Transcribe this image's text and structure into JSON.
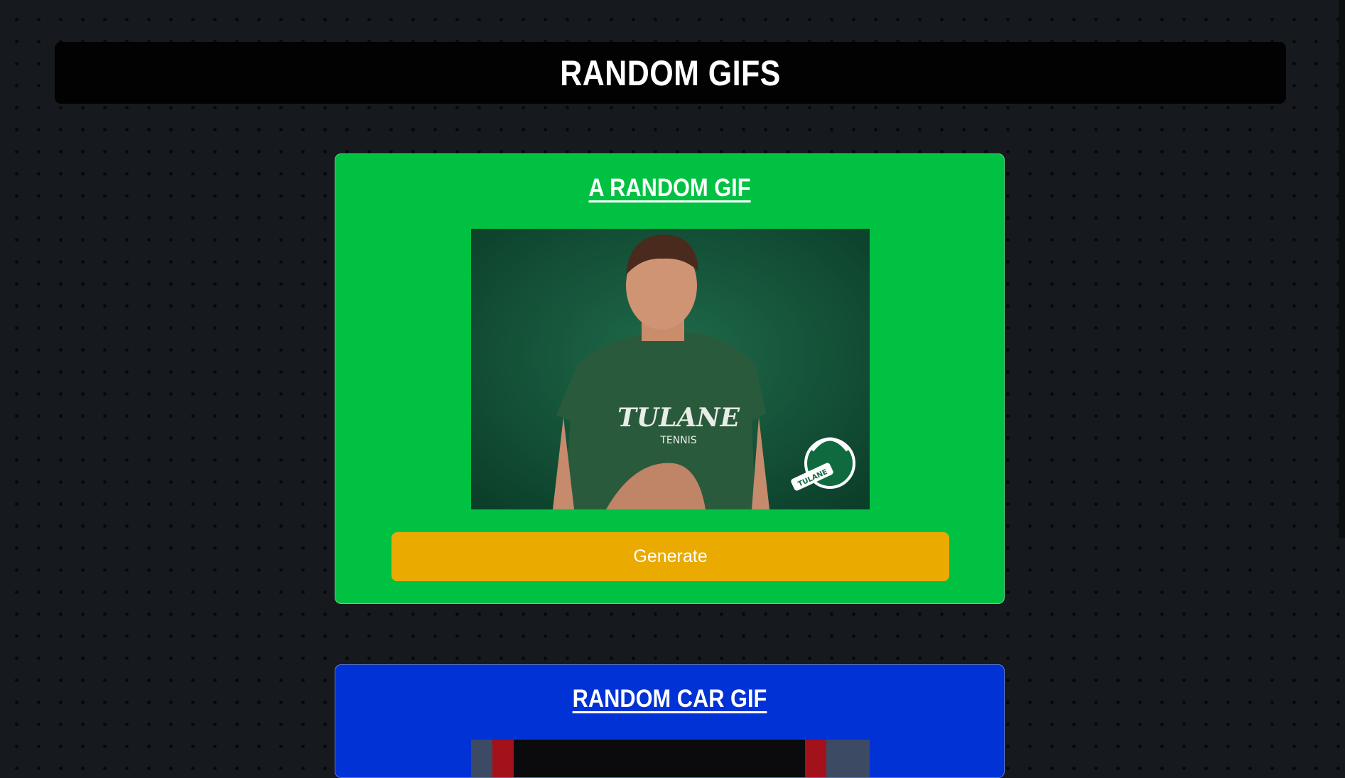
{
  "header": {
    "title": "RANDOM GIFS"
  },
  "cards": [
    {
      "title": "A RANDOM GIF",
      "gif": {
        "shirt_line1": "TULANE",
        "shirt_line2": "TENNIS",
        "logo_text": "TULANE"
      },
      "button_label": "Generate"
    },
    {
      "title": "RANDOM CAR GIF"
    }
  ],
  "colors": {
    "page_bg": "#16191d",
    "header_bg": "#020202",
    "card_green": "#00c142",
    "card_blue": "#0032d6",
    "button": "#eaaa00"
  }
}
